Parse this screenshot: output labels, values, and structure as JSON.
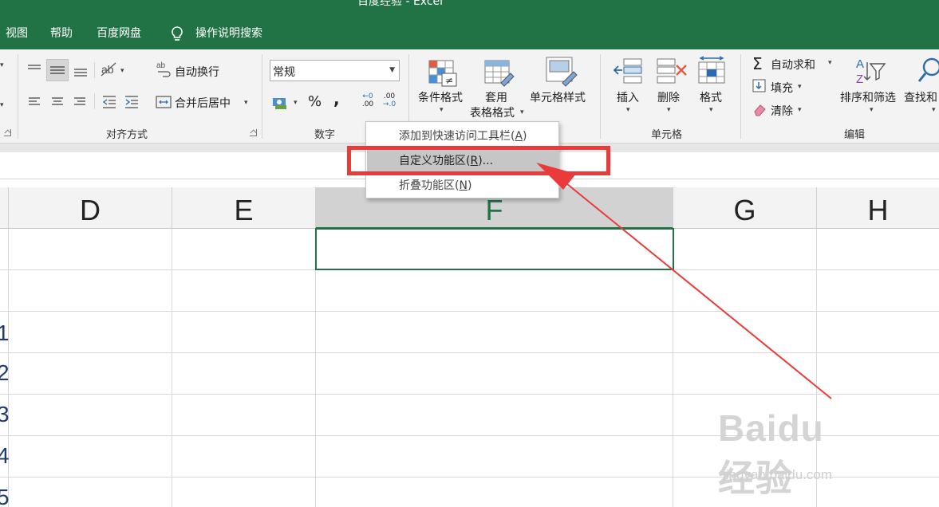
{
  "app": {
    "title": "百度经验 - Excel"
  },
  "tabs": [
    {
      "label": "视图"
    },
    {
      "label": "帮助"
    },
    {
      "label": "百度网盘"
    }
  ],
  "tell_me": {
    "label": "操作说明搜索"
  },
  "ribbon": {
    "alignment": {
      "wrap_text": "自动换行",
      "merge_center": "合并后居中",
      "group_label": "对齐方式"
    },
    "number": {
      "format_value": "常规",
      "percent": "%",
      "comma": ",",
      "inc_decimal_top": "←0",
      "inc_decimal_bottom": ".00",
      "dec_decimal_top": ".00",
      "dec_decimal_bottom": "→.0",
      "group_label": "数字"
    },
    "styles": {
      "conditional": "条件格式",
      "table_line1": "套用",
      "table_line2": "表格格式",
      "cell_styles": "单元格样式"
    },
    "cells": {
      "insert": "插入",
      "delete": "删除",
      "format": "格式",
      "group_label": "单元格"
    },
    "editing": {
      "autosum": "自动求和",
      "fill": "填充",
      "clear": "清除",
      "sort_filter": "排序和筛选",
      "find_select": "查找和",
      "group_label": "编辑"
    }
  },
  "columns": [
    {
      "label": "D"
    },
    {
      "label": "E"
    },
    {
      "label": "F"
    },
    {
      "label": "G"
    },
    {
      "label": "H"
    }
  ],
  "row_numbers": [
    "1",
    "2",
    "3",
    "4",
    "5"
  ],
  "context_menu": {
    "items": [
      {
        "text": "添加到快速访问工具栏",
        "hotkey": "A"
      },
      {
        "text": "自定义功能区",
        "hotkey": "R",
        "suffix": "..."
      },
      {
        "text": "折叠功能区",
        "hotkey": "N"
      }
    ]
  },
  "watermark": {
    "logo": "Baidu经验",
    "url": "jingyan.baidu.com"
  },
  "colors": {
    "excel_green": "#217346",
    "annotation_red": "#ea3b3b"
  }
}
